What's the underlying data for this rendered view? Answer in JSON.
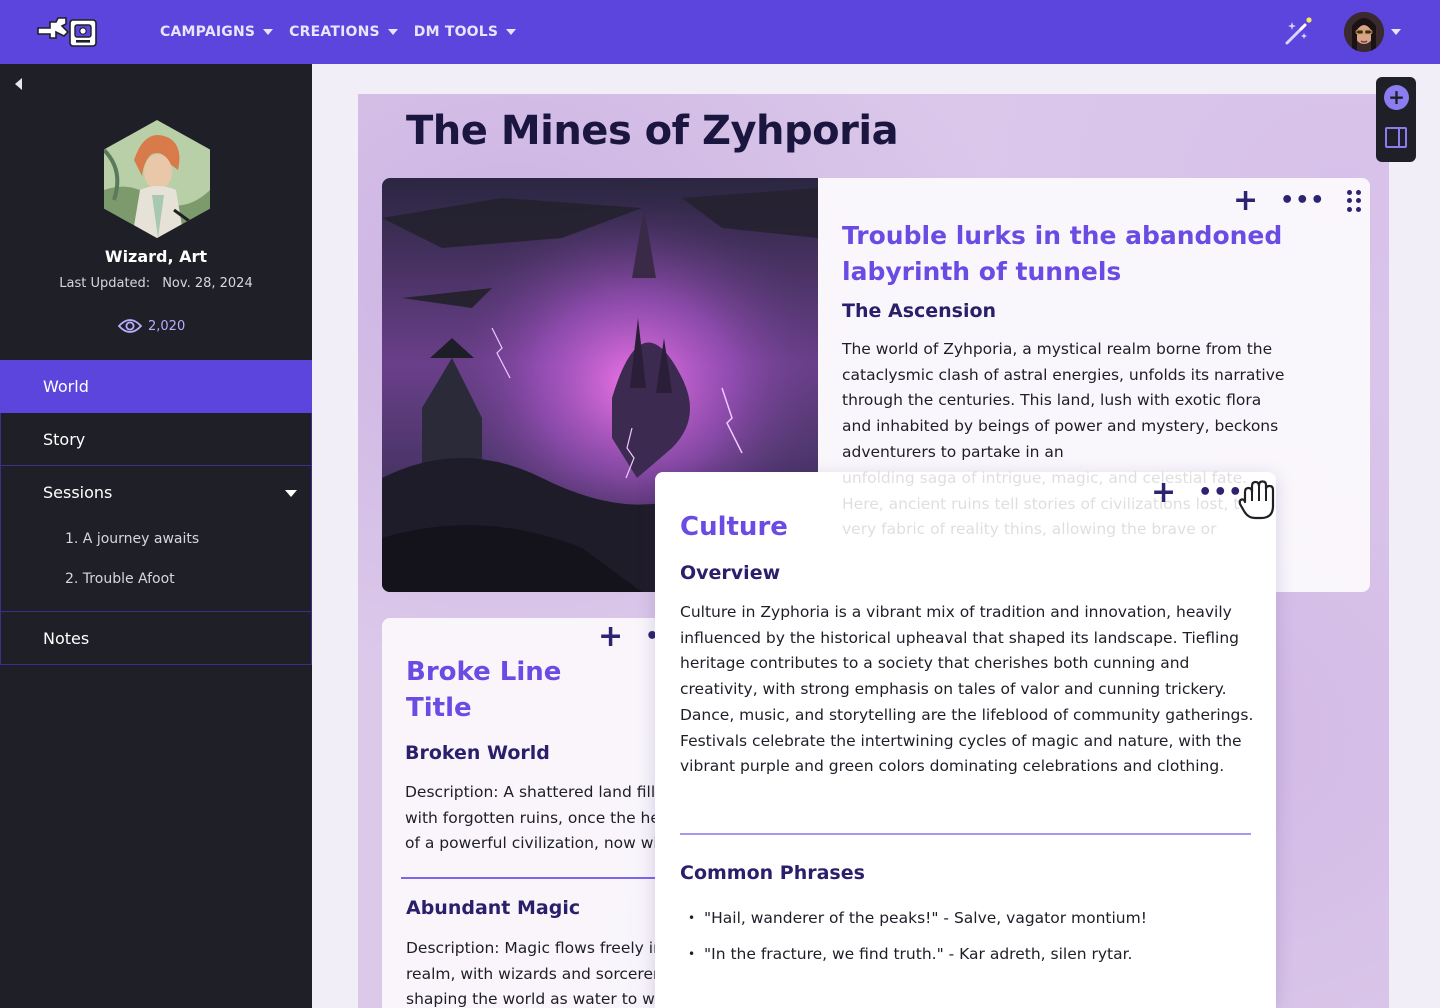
{
  "nav": {
    "items": [
      {
        "label": "CAMPAIGNS"
      },
      {
        "label": "CREATIONS"
      },
      {
        "label": "DM TOOLS"
      }
    ]
  },
  "sidebar": {
    "author": "Wizard, Art",
    "last_updated_label": "Last Updated:",
    "last_updated_date": "Nov. 28, 2024",
    "views": "2,020",
    "items": [
      {
        "label": "World",
        "active": true
      },
      {
        "label": "Story"
      },
      {
        "label": "Sessions"
      },
      {
        "label": "Notes"
      }
    ],
    "sessions": [
      {
        "label": "1. A journey awaits"
      },
      {
        "label": "2. Trouble Afoot"
      }
    ]
  },
  "page": {
    "title": "The Mines of Zyhporia"
  },
  "card1": {
    "heading": "Trouble lurks in the abandoned labyrinth of tunnels",
    "subheading": "The Ascension",
    "body": "The world of Zyhporia, a mystical realm borne from the cataclysmic clash of astral energies, unfolds its narrative through the centuries. This land, lush with exotic flora and inhabited by beings of power and mystery, beckons adventurers to partake in an",
    "overflow": "unfolding saga of intrigue, magic, and celestial fate. Here, ancient ruins tell stories of civilizations lost, the very fabric of reality thins, allowing the brave or"
  },
  "card2": {
    "title": "Broke Line Title",
    "sub1": "Broken World",
    "body1": "Description: A shattered land filled with forgotten ruins, once the heart of a powerful civilization, now wild.",
    "sub2": "Abundant Magic",
    "body2": "Description: Magic flows freely in the realm, with wizards and sorcerers shaping the world as water to will."
  },
  "card3": {
    "title": "Culture",
    "sub1": "Overview",
    "body": "Culture in Zyphoria is a vibrant mix of tradition and innovation, heavily influenced by the historical upheaval that shaped its landscape. Tiefling heritage contributes to a society that cherishes both cunning and creativity, with strong emphasis on tales of valor and cunning trickery. Dance, music, and storytelling are the lifeblood of community gatherings. Festivals celebrate the intertwining cycles of magic and nature, with the vibrant purple and green colors dominating celebrations and clothing.",
    "sub2": "Common Phrases",
    "phrases": [
      "\"Hail, wanderer of the peaks!\" - Salve, vagator montium!",
      "\"In the fracture, we find truth.\" - Kar adreth, silen rytar."
    ]
  },
  "icons": {
    "plus": "+",
    "dots": "•••"
  },
  "colors": {
    "brand": "#5c45dc",
    "sidebar_bg": "#1f2027",
    "heading_purple": "#6a4be3",
    "heading_navy": "#2a1f6a"
  }
}
